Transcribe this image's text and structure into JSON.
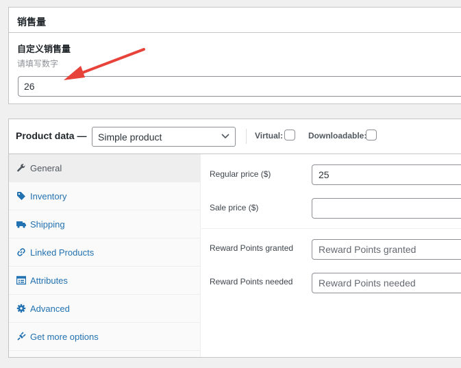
{
  "sales_box": {
    "title": "销售量",
    "field_label": "自定义销售量",
    "field_description": "请填写数字",
    "field_value": "26"
  },
  "product_data": {
    "title": "Product data —",
    "type_select": "Simple product",
    "virtual_label": "Virtual:",
    "downloadable_label": "Downloadable:",
    "tabs": [
      {
        "label": "General",
        "icon": "wrench-icon"
      },
      {
        "label": "Inventory",
        "icon": "tag-icon"
      },
      {
        "label": "Shipping",
        "icon": "truck-icon"
      },
      {
        "label": "Linked Products",
        "icon": "link-icon"
      },
      {
        "label": "Attributes",
        "icon": "list-icon"
      },
      {
        "label": "Advanced",
        "icon": "gear-icon"
      },
      {
        "label": "Get more options",
        "icon": "plugin-icon"
      }
    ],
    "active_tab": "General",
    "fields": {
      "regular_price_label": "Regular price ($)",
      "regular_price_value": "25",
      "sale_price_label": "Sale price ($)",
      "sale_price_value": "",
      "reward_granted_label": "Reward Points granted",
      "reward_granted_placeholder": "Reward Points granted",
      "reward_needed_label": "Reward Points needed",
      "reward_needed_placeholder": "Reward Points needed"
    }
  },
  "colors": {
    "accent_link": "#2271b1",
    "annotation_arrow": "#e8433a",
    "page_bg": "#f0f0f1"
  }
}
